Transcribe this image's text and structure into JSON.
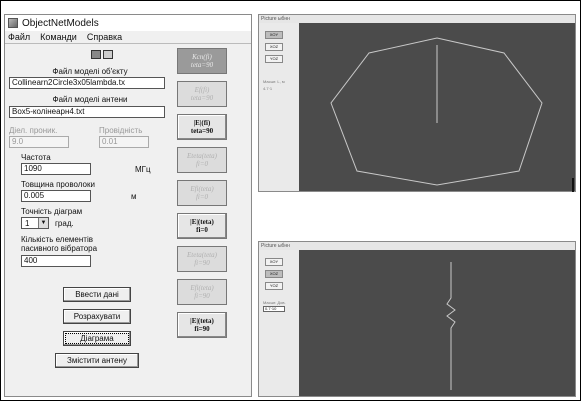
{
  "window": {
    "title": "ObjectNetModels",
    "menu": [
      "Файл",
      "Команди",
      "Справка"
    ]
  },
  "form": {
    "object_model_label": "Файл моделі об'єкту",
    "object_model_value": "Collinearn2Circle3x05lambda.tx",
    "antenna_model_label": "Файл моделі антени",
    "antenna_model_value": "Box5-колінеарн4.txt",
    "dielectric_label": "Діел. проник.",
    "dielectric_value": "9.0",
    "conductivity_label": "Провідність",
    "conductivity_value": "0.01",
    "frequency_label": "Частота",
    "frequency_value": "1090",
    "frequency_unit": "МГц",
    "wire_thickness_label": "Товщина проволоки",
    "wire_thickness_value": "0.005",
    "wire_thickness_unit": "м",
    "diagram_accuracy_label": "Точність діаграм",
    "diagram_accuracy_value": "1",
    "diagram_accuracy_unit": "град.",
    "elements_count_label_1": "Кількість елементів",
    "elements_count_label_2": "пасивного вібратора",
    "elements_count_value": "400"
  },
  "actions": {
    "enter_data": "Ввести дані",
    "calculate": "Розрахувати",
    "diagram": "Діаграма",
    "shift_antenna": "Змістити антену"
  },
  "diagram_buttons": [
    {
      "line1": "Ксп(fi)",
      "line2": "teta=90",
      "state": "pressed"
    },
    {
      "line1": "Ef(fi)",
      "line2": "teta=90",
      "state": "disabled"
    },
    {
      "line1": "|E|(fi)",
      "line2": "teta=90",
      "state": "active"
    },
    {
      "line1": "Eteta(teta)",
      "line2": "fi=0",
      "state": "disabled"
    },
    {
      "line1": "Efi(teta)",
      "line2": "fi=0",
      "state": "disabled"
    },
    {
      "line1": "|E|(teta)",
      "line2": "fi=0",
      "state": "active"
    },
    {
      "line1": "Eteta(teta)",
      "line2": "fi=90",
      "state": "disabled"
    },
    {
      "line1": "Efi(teta)",
      "line2": "fi=90",
      "state": "disabled"
    },
    {
      "line1": "|E|(teta)",
      "line2": "fi=90",
      "state": "active"
    }
  ],
  "plot_top": {
    "title": "Picture ыбнн",
    "buttons": [
      "XOY",
      "XOZ",
      "YOZ"
    ],
    "active_index": 0,
    "side_label": "Масшт. L, м",
    "side_value": "4.7·1"
  },
  "plot_bottom": {
    "title": "Picture ыбнн",
    "buttons": [
      "XOY",
      "XOZ",
      "YOZ"
    ],
    "active_index": 1,
    "side_label": "Масшт. Дов.",
    "side_value": "0.7·10"
  },
  "colors": {
    "plot_background": "#4b4b4b",
    "plot_line": "#c8c8c8"
  }
}
